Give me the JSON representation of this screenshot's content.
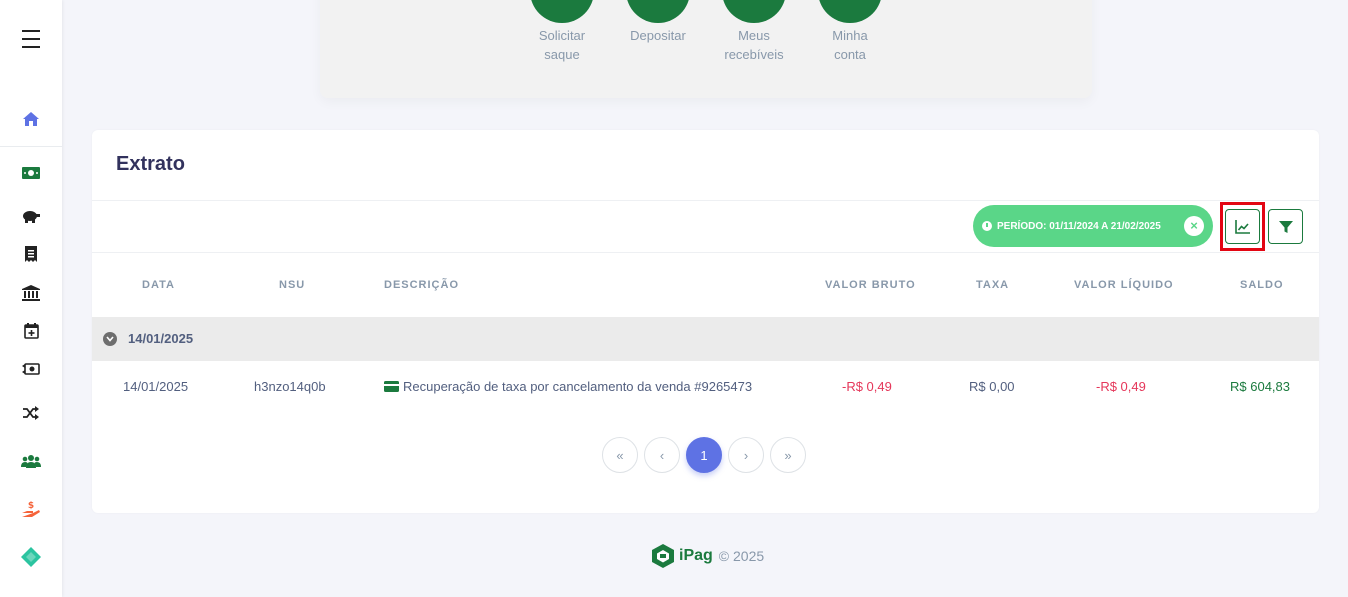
{
  "sidebar": {
    "items": [
      {
        "name": "menu-icon",
        "color": "#222222"
      },
      {
        "name": "home-icon",
        "color": "#5e72e4"
      },
      {
        "name": "money-bill-icon",
        "color": "#1b7a3e"
      },
      {
        "name": "piggy-bank-icon",
        "color": "#222222"
      },
      {
        "name": "receipt-icon",
        "color": "#222222"
      },
      {
        "name": "bank-icon",
        "color": "#222222"
      },
      {
        "name": "calendar-plus-icon",
        "color": "#222222"
      },
      {
        "name": "money-transfer-icon",
        "color": "#222222"
      },
      {
        "name": "shuffle-icon",
        "color": "#222222"
      },
      {
        "name": "users-icon",
        "color": "#1b7a3e"
      },
      {
        "name": "hand-dollar-icon",
        "color": "#f5633a"
      },
      {
        "name": "diamond-icon",
        "color": "#2bc4a0"
      }
    ]
  },
  "quick_actions": [
    {
      "label": "Solicitar\nsaque",
      "icon": "hand-dollar-icon"
    },
    {
      "label": "Depositar",
      "icon": "deposit-icon"
    },
    {
      "label": "Meus\nrecebíveis",
      "icon": "card-icon"
    },
    {
      "label": "Minha\nconta",
      "icon": "bank-icon"
    }
  ],
  "extrato": {
    "title": "Extrato",
    "period_filter": "PERÍODO: 01/11/2024 A 21/02/2025",
    "columns": [
      "DATA",
      "NSU",
      "DESCRIÇÃO",
      "VALOR BRUTO",
      "TAXA",
      "VALOR LÍQUIDO",
      "SALDO"
    ],
    "groups": [
      {
        "date": "14/01/2025",
        "rows": [
          {
            "data": "14/01/2025",
            "nsu": "h3nzo14q0b",
            "descricao": "Recuperação de taxa por cancelamento da venda #9265473",
            "valor_bruto": "-R$ 0,49",
            "taxa": "R$ 0,00",
            "valor_liquido": "-R$ 0,49",
            "saldo": "R$ 604,83"
          }
        ]
      }
    ]
  },
  "pagination": {
    "first": "«",
    "prev": "‹",
    "current": "1",
    "next": "›",
    "last": "»"
  },
  "footer": {
    "brand": "iPag",
    "copyright": "© 2025"
  },
  "colors": {
    "brand_green": "#1b7a3e",
    "chip_green": "#5ad688",
    "accent_blue": "#5e72e4",
    "negative": "#e5375a",
    "highlight_red": "#e30613"
  }
}
